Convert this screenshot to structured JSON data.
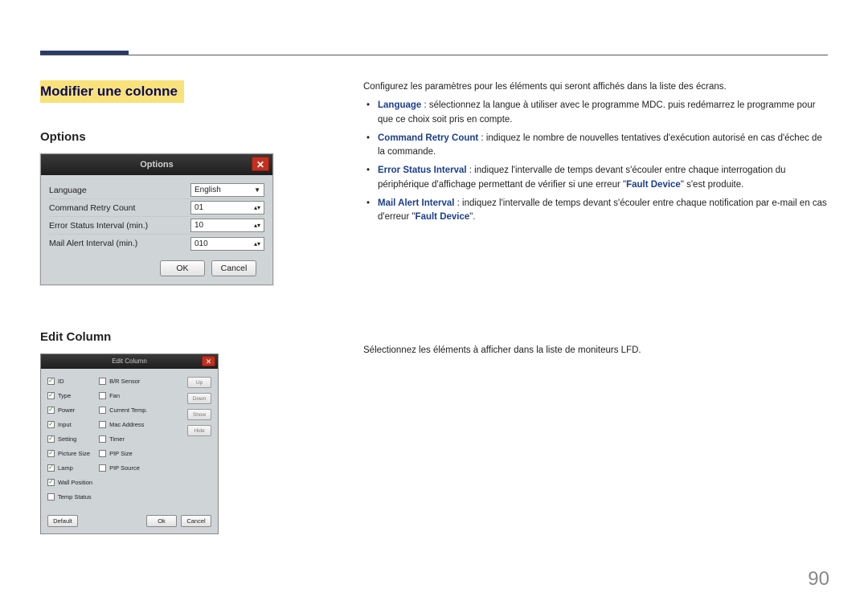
{
  "page": {
    "heading_hl": "Modifier une colonne",
    "page_num": "90"
  },
  "options_section": {
    "title": "Options",
    "dialog_title": "Options",
    "rows": {
      "language_label": "Language",
      "language_value": "English",
      "retry_label": "Command Retry Count",
      "retry_value": "01",
      "err_label": "Error Status Interval (min.)",
      "err_value": "10",
      "mail_label": "Mail Alert Interval (min.)",
      "mail_value": "010"
    },
    "buttons": {
      "ok": "OK",
      "cancel": "Cancel"
    }
  },
  "edit_column_section": {
    "title": "Edit Column",
    "dialog_title": "Edit Column",
    "col1": [
      "ID",
      "Type",
      "Power",
      "Input",
      "Setting",
      "Picture Size",
      "Lamp",
      "Wall Position",
      "Temp Status"
    ],
    "col1_checked": [
      true,
      true,
      true,
      true,
      true,
      true,
      true,
      true,
      false
    ],
    "col2": [
      "B/R Sensor",
      "Fan",
      "Current Temp.",
      "Mac Address",
      "Timer",
      "PIP Size",
      "PIP Source"
    ],
    "col2_checked": [
      false,
      false,
      false,
      false,
      false,
      false,
      false
    ],
    "side_buttons": [
      "Up",
      "Down",
      "Show",
      "Hide"
    ],
    "footer": {
      "default": "Default",
      "ok": "Ok",
      "cancel": "Cancel"
    },
    "desc": "Sélectionnez les éléments à afficher dans la liste de moniteurs LFD."
  },
  "right_text": {
    "intro": "Configurez les paramètres pour les éléments qui seront affichés dans la liste des écrans.",
    "b1_term": "Language",
    "b1_rest": " : sélectionnez la langue à utiliser avec le programme MDC. puis redémarrez le programme pour que ce choix soit pris en compte.",
    "b2_term": "Command Retry Count",
    "b2_rest": " : indiquez le nombre de nouvelles tentatives d'exécution autorisé en cas d'échec de la commande.",
    "b3_term": "Error Status Interval",
    "b3_rest_a": " : indiquez l'intervalle de temps devant s'écouler entre chaque interrogation du périphérique d'affichage permettant de vérifier si une erreur \"",
    "b3_quoted": "Fault Device",
    "b3_rest_b": "\" s'est produite.",
    "b4_term": "Mail Alert Interval",
    "b4_rest_a": " : indiquez l'intervalle de temps devant s'écouler entre chaque notification par e-mail en cas d'erreur \"",
    "b4_quoted": "Fault Device",
    "b4_rest_b": "\"."
  }
}
